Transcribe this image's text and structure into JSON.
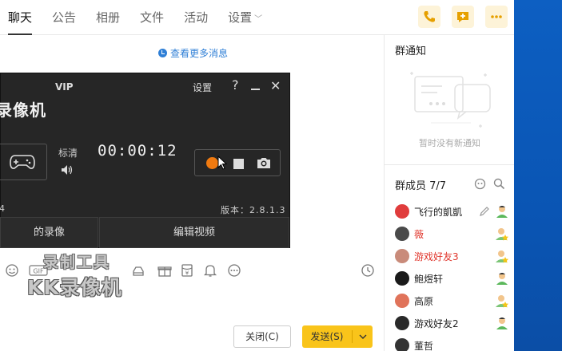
{
  "nav": {
    "tabs": [
      {
        "label": "聊天",
        "active": true
      },
      {
        "label": "公告"
      },
      {
        "label": "相册"
      },
      {
        "label": "文件"
      },
      {
        "label": "活动"
      },
      {
        "label": "设置"
      }
    ],
    "actions": [
      "phone-icon",
      "add-message-icon",
      "more-icon"
    ],
    "accent": "#f5b400"
  },
  "chat": {
    "more_messages": "查看更多消息"
  },
  "recorder": {
    "vip": "VIP",
    "settings": "设置",
    "help": "?",
    "close": "✕",
    "title": "录像机",
    "quality": "标清",
    "timer": "00:00:12",
    "fps_partial": "4",
    "version": "版本：2.8.1.3",
    "btn_left": "的录像",
    "btn_right": "编辑视频"
  },
  "notice": {
    "title": "群通知",
    "empty": "暂时没有新通知"
  },
  "members": {
    "title": "群成员 7/7",
    "list": [
      {
        "name": "飞行的凱凱",
        "red": false,
        "color": "#e03c3c"
      },
      {
        "name": "薇",
        "red": true,
        "color": "#4a4a4a"
      },
      {
        "name": "游戏好友3",
        "red": true,
        "color": "#c98b7a"
      },
      {
        "name": "鲍煜轩",
        "red": false,
        "color": "#1a1a1a"
      },
      {
        "name": "高原",
        "red": false,
        "color": "#e0735a"
      },
      {
        "name": "游戏好友2",
        "red": false,
        "color": "#2a2a2a"
      },
      {
        "name": "董哲",
        "red": false,
        "color": "#333333"
      }
    ]
  },
  "watermark": {
    "line1": "录制工具",
    "line2": "KK录像机"
  },
  "footer": {
    "close_label": "关闭(C)",
    "send_label": "发送(S)"
  }
}
